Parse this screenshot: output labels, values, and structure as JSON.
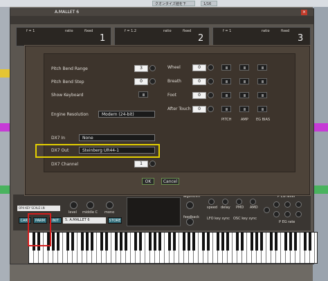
{
  "host": {
    "toolbar_text": "クオンタイズ値を下",
    "quantize": "1/16"
  },
  "plugin": {
    "title": "A.MALLET 6",
    "operators": [
      {
        "label_left": "f = 1",
        "label_ratio": "ratio",
        "label_mode": "fixed",
        "number": "1"
      },
      {
        "label_left": "f = 1.2",
        "label_ratio": "ratio",
        "label_mode": "fixed",
        "number": "2"
      },
      {
        "label_left": "f = 1",
        "label_ratio": "ratio",
        "label_mode": "fixed",
        "number": "3"
      }
    ],
    "close_glyph": "×"
  },
  "dialog": {
    "pitch_bend_range_label": "Pitch Bend Range",
    "pitch_bend_range_value": "3",
    "pitch_bend_step_label": "Pitch Bend Step",
    "pitch_bend_step_value": "0",
    "show_keyboard_label": "Show Keyboard",
    "engine_resolution_label": "Engine Resolution",
    "engine_resolution_value": "Modern (24-bit)",
    "dx7_in_label": "DX7 In",
    "dx7_in_value": "None",
    "dx7_out_label": "DX7 Out",
    "dx7_out_value": "Steinberg UR44-1",
    "dx7_channel_label": "DX7 Channel",
    "dx7_channel_value": "1",
    "wheel_label": "Wheel",
    "wheel_value": "0",
    "breath_label": "Breath",
    "breath_value": "0",
    "foot_label": "Foot",
    "foot_value": "0",
    "aftertouch_label": "After Touch",
    "aftertouch_value": "0",
    "col_pitch": "PITCH",
    "col_amp": "AMP",
    "col_eg_bias": "EG BIAS",
    "ok_label": "OK",
    "cancel_label": "Cancel"
  },
  "bottom": {
    "cart_label": "CART",
    "parm_label": "PARM",
    "init_label": "INIT",
    "store_label": "STORE",
    "preset_name": "5. A.MALLET 6",
    "level_label": "level",
    "middle_c_label": "middle C",
    "mono_label": "mono",
    "algorithm_label": "algorithm",
    "feedback_label": "feedback",
    "speed_label": "speed",
    "delay_label": "delay",
    "pmd_label": "PMD",
    "amd_label": "AMD",
    "lfo_key_sync_label": "LFO key sync",
    "osc_key_sync_label": "OSC key sync",
    "p_eg_rate_label": "P EG rate",
    "p_eg_level_label": "P EG level",
    "op_text": "OP4 KEY SCALE LN"
  }
}
